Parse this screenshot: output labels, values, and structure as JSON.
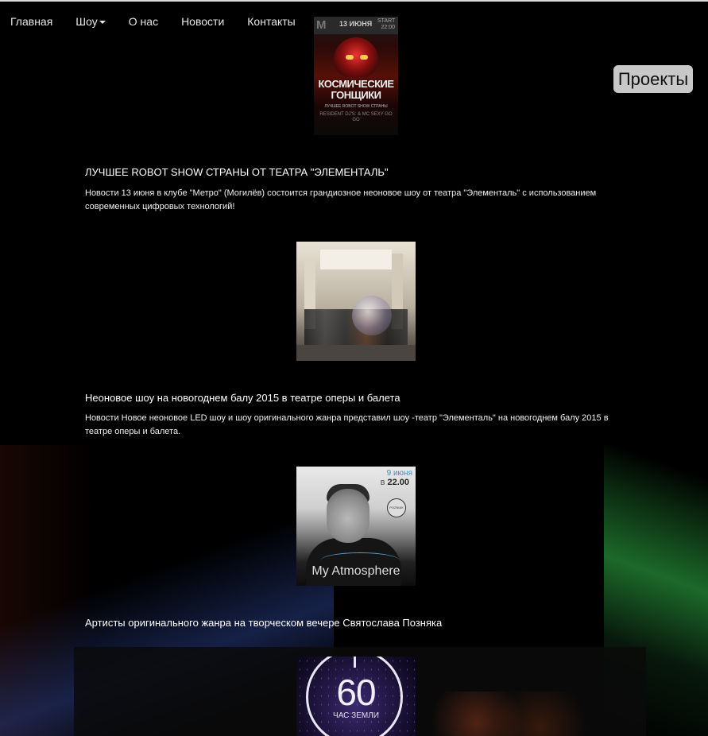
{
  "nav": {
    "items": [
      "Главная",
      "Шоу",
      "О нас",
      "Новости",
      "Контакты"
    ]
  },
  "projects_button": "Проекты",
  "posters": {
    "kosmicheskie": {
      "logo_letter": "M",
      "date": "13 ИЮНЯ",
      "start": "START 22:00",
      "title": "КОСМИЧЕСКИЕ ГОНЩИКИ",
      "subtitle": "ЛУЧШЕЕ ROBOT SHOW СТРАНЫ",
      "location": "RESIDENT DJ'S: & MC SEXY GO GO"
    },
    "atmosphere": {
      "date": "9 июня",
      "time_prefix": "в",
      "time": "22.00",
      "logo_text": "POZNIAK",
      "title": "My Atmosphere"
    },
    "earth_hour": {
      "number": "60",
      "caption": "ЧАС ЗЕМЛИ"
    }
  },
  "articles": [
    {
      "title": "ЛУЧШЕЕ ROBOT SHOW СТРАНЫ ОТ ТЕАТРА \"ЭЛЕМЕНТАЛЬ\"",
      "desc": "Новости 13 июня в клубе \"Метро\" (Могилёв) состоится грандиозное неоновое шоу от театра \"Элементаль\" с использованием современных цифровых технологий!"
    },
    {
      "title": "Неоновое шоу на новогоднем балу 2015 в театре оперы и балета",
      "desc": "Новости Новое неоновое LED шоу и шоу оригинального жанра представил шоу -театр \"Элементаль\" на новогоднем балу 2015 в театре оперы и балета."
    },
    {
      "title": "Артисты оригинального жанра на творческом вечере Святослава Позняка",
      "desc": ""
    }
  ]
}
